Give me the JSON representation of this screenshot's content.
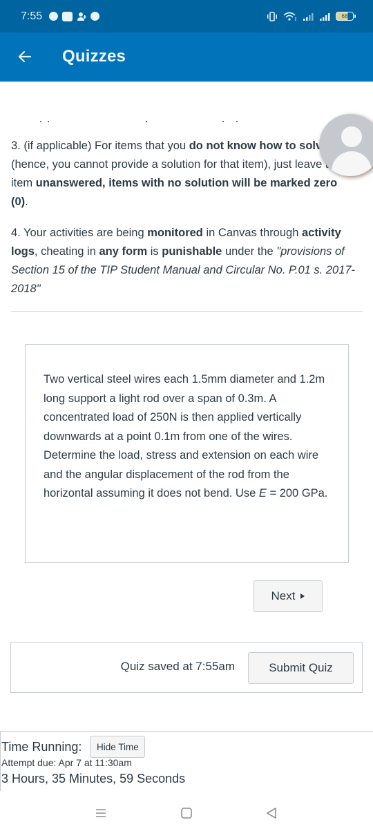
{
  "status_bar": {
    "time": "7:55",
    "left_icons": [
      "messenger-icon",
      "news-app-icon",
      "add-contact-icon",
      "sync-app-icon"
    ],
    "right_icons": [
      "vibrate-icon",
      "wifi-icon",
      "signal-icon-1",
      "signal-icon-2",
      "battery-icon"
    ],
    "battery_level": "68"
  },
  "app_bar": {
    "back_label": "←",
    "title": "Quizzes"
  },
  "instructions": {
    "item3": {
      "p1": "3. (if applicable) For items that you ",
      "b1": "do not know how to solve",
      "p2": " (hence, you cannot provide a solution for that item), just leave the item ",
      "b2": "unanswered, items with no solution will be marked zero (0)",
      "p3": "."
    },
    "item4": {
      "p1": "4. Your activities are being ",
      "b1": "monitored",
      "p2": " in Canvas through ",
      "b2": "activity logs",
      "p3": ", cheating in ",
      "b3": "any form",
      "p4": " is ",
      "b4": "punishable",
      "p5": " under the ",
      "i1": "\"provisions of Section 15 of the TIP Student Manual and Circular No. P.01 s. 2017-2018\""
    }
  },
  "question": {
    "text_before_E": "Two vertical steel wires each 1.5mm diameter and 1.2m long support a light rod over a span of 0.3m. A concentrated load of 250N is then applied vertically downwards at a point 0.1m from one of the wires. Determine the load, stress and extension on each wire and the angular displacement of the rod from the horizontal assuming it does not bend. Use ",
    "E_symbol": "E",
    "text_after_E": " = 200 GPa."
  },
  "navigation": {
    "next_label": "Next"
  },
  "submit_bar": {
    "saved_text": "Quiz saved at 7:55am",
    "submit_label": "Submit Quiz"
  },
  "timer": {
    "label": "Time Running:",
    "hide_label": "Hide Time",
    "attempt_due": "Attempt due: Apr 7 at 11:30am",
    "time_left": "3 Hours, 35 Minutes, 59 Seconds"
  },
  "system_nav": {
    "recents": "recents-icon",
    "home": "home-icon",
    "back": "back-icon"
  },
  "colors": {
    "status_bar": "#0064a0",
    "app_bar": "#0073bb",
    "text": "#2d3b45",
    "border": "#c7cdd1",
    "button_bg": "#f5f5f5"
  }
}
